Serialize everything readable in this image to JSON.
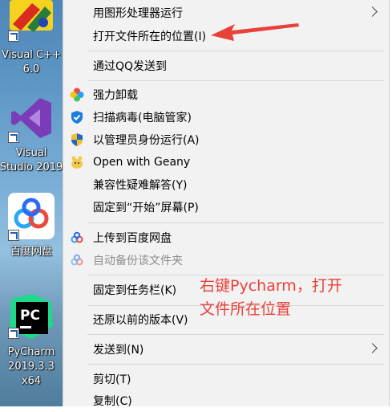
{
  "desktop": {
    "icons": [
      {
        "label_line1": "Visual C++",
        "label_line2": "6.0"
      },
      {
        "label_line1": "Visual",
        "label_line2": "Studio 2019"
      },
      {
        "label_line1": "百度网盘",
        "label_line2": ""
      },
      {
        "label_line1": "PyCharm",
        "label_line2": "2019.3.3",
        "label_line3": "x64"
      }
    ]
  },
  "menu": {
    "items": [
      {
        "label": "用图形处理器运行"
      },
      {
        "label": "打开文件所在的位置(I)"
      },
      {
        "label": "通过QQ发送到"
      },
      {
        "label": "强力卸载"
      },
      {
        "label": "扫描病毒(电脑管家)"
      },
      {
        "label": "以管理员身份运行(A)"
      },
      {
        "label": "Open with Geany"
      },
      {
        "label": "兼容性疑难解答(Y)"
      },
      {
        "label": "固定到“开始”屏幕(P)"
      },
      {
        "label": "上传到百度网盘"
      },
      {
        "label": "自动备份该文件夹"
      },
      {
        "label": "固定到任务栏(K)"
      },
      {
        "label": "还原以前的版本(V)"
      },
      {
        "label": "发送到(N)"
      },
      {
        "label": "剪切(T)"
      },
      {
        "label": "复制(C)"
      }
    ]
  },
  "annotation": {
    "line1": "右键Pycharm，打开",
    "line2": "文件所在位置",
    "color": "#e8413a"
  }
}
